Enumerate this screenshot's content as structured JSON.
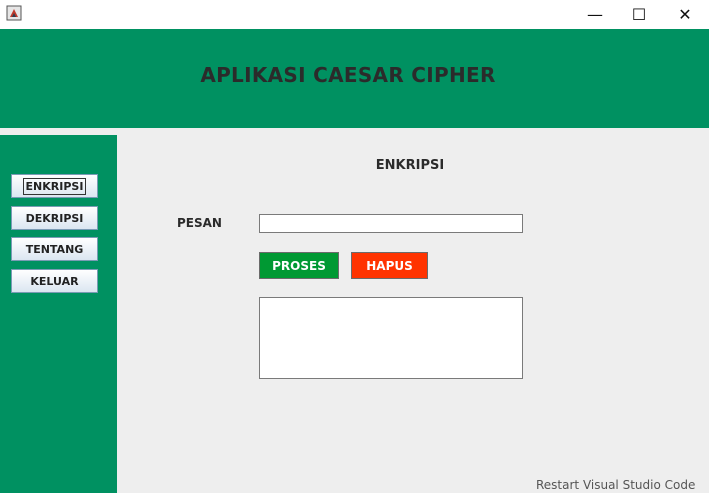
{
  "window": {
    "minimize_glyph": "—",
    "maximize_glyph": "☐",
    "close_glyph": "✕"
  },
  "header": {
    "title": "APLIKASI CAESAR CIPHER"
  },
  "sidebar": {
    "items": [
      {
        "label": "ENKRIPSI",
        "focused": true
      },
      {
        "label": "DEKRIPSI"
      },
      {
        "label": "TENTANG"
      },
      {
        "label": "KELUAR"
      }
    ]
  },
  "main": {
    "section_title": "ENKRIPSI",
    "pesan_label": "PESAN",
    "pesan_value": "",
    "proses_label": "PROSES",
    "hapus_label": "HAPUS",
    "output_value": ""
  },
  "background_fragment": "Restart Visual Studio Code",
  "colors": {
    "header": "#009161",
    "sidebar": "#009161",
    "content_bg": "#eeeeee",
    "proses": "#009933",
    "hapus": "#ff3300"
  }
}
